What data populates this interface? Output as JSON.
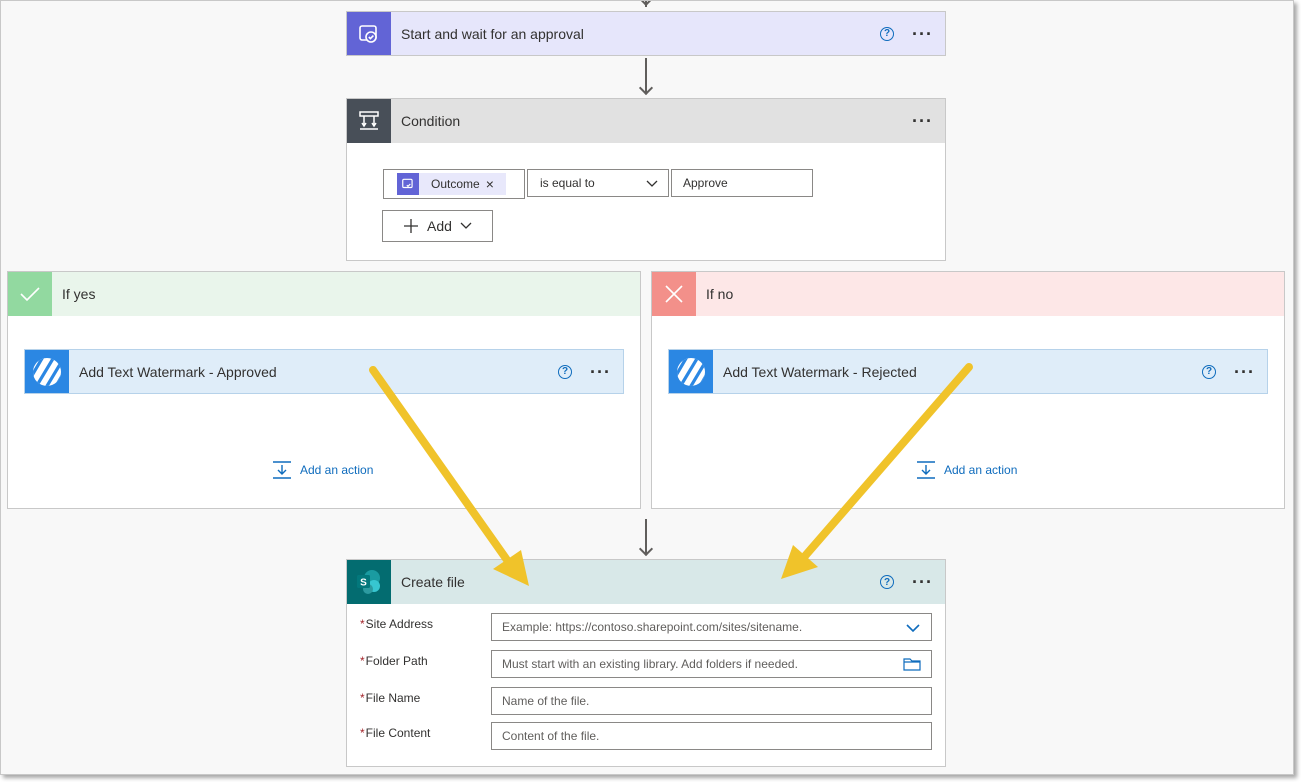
{
  "approval": {
    "title": "Start and wait for an approval",
    "help": "?",
    "more": "···",
    "color": "#6264d6"
  },
  "condition": {
    "title": "Condition",
    "more": "···",
    "token_label": "Outcome",
    "token_remove": "×",
    "operator": "is equal to",
    "value": "Approve",
    "add_label": "Add",
    "color": "#484f58"
  },
  "branch_yes": {
    "title": "If yes",
    "action_title": "Add Text Watermark - Approved",
    "help": "?",
    "more": "···",
    "add_action": "Add an action",
    "color": "#92d9a0"
  },
  "branch_no": {
    "title": "If no",
    "action_title": "Add Text Watermark - Rejected",
    "help": "?",
    "more": "···",
    "add_action": "Add an action",
    "color": "#f3908a"
  },
  "create_file": {
    "title": "Create file",
    "help": "?",
    "more": "···",
    "color": "#036c70",
    "icon_letter": "S",
    "fields": [
      {
        "label": "Site Address",
        "required": "*",
        "placeholder": "Example: https://contoso.sharepoint.com/sites/sitename."
      },
      {
        "label": "Folder Path",
        "required": "*",
        "placeholder": "Must start with an existing library. Add folders if needed."
      },
      {
        "label": "File Name",
        "required": "*",
        "placeholder": "Name of the file."
      },
      {
        "label": "File Content",
        "required": "*",
        "placeholder": "Content of the file."
      }
    ]
  },
  "annotation_color": "#f0c32a"
}
